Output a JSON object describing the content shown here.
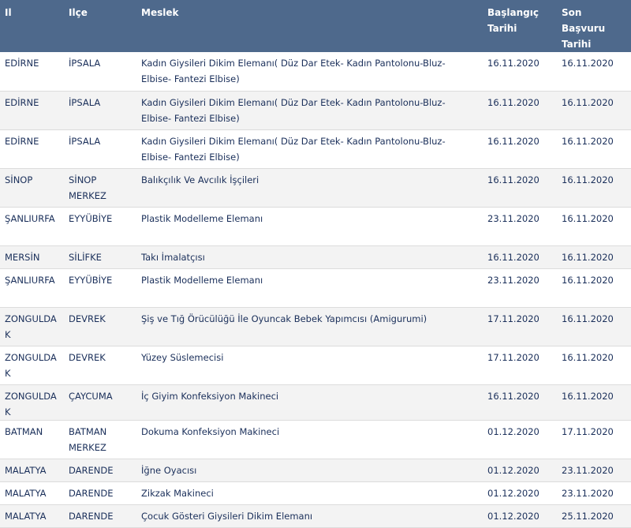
{
  "table": {
    "headers": {
      "il": "Il",
      "ilce": "Ilçe",
      "meslek": "Meslek",
      "baslangic": "Başlangıç Tarihi",
      "son_basvuru": "Son Başvuru Tarihi"
    },
    "rows": [
      {
        "il": "EDİRNE",
        "ilce": "İPSALA",
        "meslek": "Kadın Giysileri Dikim Elemanı( Düz Dar Etek- Kadın Pantolonu-Bluz- Elbise- Fantezi Elbise)",
        "baslangic": "16.11.2020",
        "son_basvuru": "16.11.2020"
      },
      {
        "il": "EDİRNE",
        "ilce": "İPSALA",
        "meslek": "Kadın Giysileri Dikim Elemanı( Düz Dar Etek- Kadın Pantolonu-Bluz- Elbise- Fantezi Elbise)",
        "baslangic": "16.11.2020",
        "son_basvuru": "16.11.2020"
      },
      {
        "il": "EDİRNE",
        "ilce": "İPSALA",
        "meslek": "Kadın Giysileri Dikim Elemanı( Düz Dar Etek- Kadın Pantolonu-Bluz- Elbise- Fantezi Elbise)",
        "baslangic": "16.11.2020",
        "son_basvuru": "16.11.2020"
      },
      {
        "il": "SİNOP",
        "ilce": "SİNOP MERKEZ",
        "meslek": "Balıkçılık Ve Avcılık İşçileri",
        "baslangic": "16.11.2020",
        "son_basvuru": "16.11.2020"
      },
      {
        "il": "ŞANLIURFA",
        "ilce": "EYYÜBİYE",
        "meslek": "Plastik Modelleme Elemanı",
        "baslangic": "23.11.2020",
        "son_basvuru": "16.11.2020"
      },
      {
        "il": "MERSİN",
        "ilce": "SİLİFKE",
        "meslek": "Takı İmalatçısı",
        "baslangic": "16.11.2020",
        "son_basvuru": "16.11.2020"
      },
      {
        "il": "ŞANLIURFA",
        "ilce": "EYYÜBİYE",
        "meslek": "Plastik Modelleme Elemanı",
        "baslangic": "23.11.2020",
        "son_basvuru": "16.11.2020"
      },
      {
        "il": "ZONGULDAK",
        "ilce": "DEVREK",
        "meslek": "Şiş ve Tığ Örücülüğü İle Oyuncak Bebek Yapımcısı (Amigurumi)",
        "baslangic": "17.11.2020",
        "son_basvuru": "16.11.2020"
      },
      {
        "il": "ZONGULDAK",
        "ilce": "DEVREK",
        "meslek": "Yüzey Süslemecisi",
        "baslangic": "17.11.2020",
        "son_basvuru": "16.11.2020"
      },
      {
        "il": "ZONGULDAK",
        "ilce": "ÇAYCUMA",
        "meslek": "İç Giyim Konfeksiyon Makineci",
        "baslangic": "16.11.2020",
        "son_basvuru": "16.11.2020"
      },
      {
        "il": "BATMAN",
        "ilce": "BATMAN MERKEZ",
        "meslek": "Dokuma Konfeksiyon Makineci",
        "baslangic": "01.12.2020",
        "son_basvuru": "17.11.2020"
      },
      {
        "il": "MALATYA",
        "ilce": "DARENDE",
        "meslek": "İğne Oyacısı",
        "baslangic": "01.12.2020",
        "son_basvuru": "23.11.2020"
      },
      {
        "il": "MALATYA",
        "ilce": "DARENDE",
        "meslek": "Zikzak Makineci",
        "baslangic": "01.12.2020",
        "son_basvuru": "23.11.2020"
      },
      {
        "il": "MALATYA",
        "ilce": "DARENDE",
        "meslek": "Çocuk Gösteri Giysileri Dikim Elemanı",
        "baslangic": "01.12.2020",
        "son_basvuru": "25.11.2020"
      }
    ]
  }
}
